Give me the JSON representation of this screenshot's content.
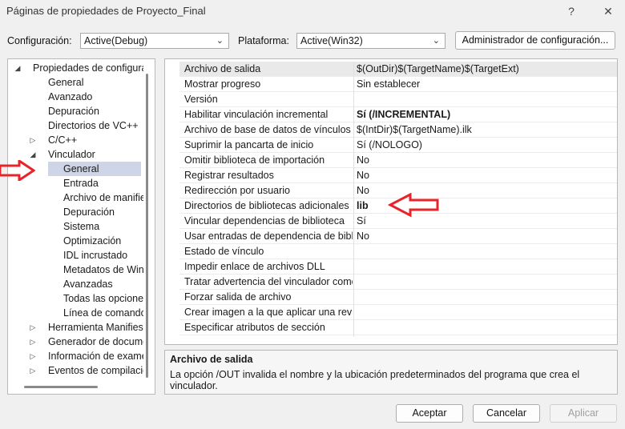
{
  "window": {
    "title": "Páginas de propiedades de Proyecto_Final",
    "help_icon": "?",
    "close_icon": "✕"
  },
  "toolbar": {
    "config_label": "Configuración:",
    "config_value": "Active(Debug)",
    "platform_label": "Plataforma:",
    "platform_value": "Active(Win32)",
    "config_manager_label": "Administrador de configuración..."
  },
  "tree": {
    "items": [
      {
        "label": "Propiedades de configuraci",
        "level": 0,
        "expander": "◢"
      },
      {
        "label": "General",
        "level": 1,
        "expander": ""
      },
      {
        "label": "Avanzado",
        "level": 1,
        "expander": ""
      },
      {
        "label": "Depuración",
        "level": 1,
        "expander": ""
      },
      {
        "label": "Directorios de VC++",
        "level": 1,
        "expander": ""
      },
      {
        "label": "C/C++",
        "level": 1,
        "expander": "▷"
      },
      {
        "label": "Vinculador",
        "level": 1,
        "expander": "◢"
      },
      {
        "label": "General",
        "level": 2,
        "expander": "",
        "selected": true
      },
      {
        "label": "Entrada",
        "level": 2,
        "expander": ""
      },
      {
        "label": "Archivo de manifies",
        "level": 2,
        "expander": ""
      },
      {
        "label": "Depuración",
        "level": 2,
        "expander": ""
      },
      {
        "label": "Sistema",
        "level": 2,
        "expander": ""
      },
      {
        "label": "Optimización",
        "level": 2,
        "expander": ""
      },
      {
        "label": "IDL incrustado",
        "level": 2,
        "expander": ""
      },
      {
        "label": "Metadatos de Windo",
        "level": 2,
        "expander": ""
      },
      {
        "label": "Avanzadas",
        "level": 2,
        "expander": ""
      },
      {
        "label": "Todas las opciones",
        "level": 2,
        "expander": ""
      },
      {
        "label": "Línea de comandos",
        "level": 2,
        "expander": ""
      },
      {
        "label": "Herramienta Manifiesto",
        "level": 1,
        "expander": "▷"
      },
      {
        "label": "Generador de documen",
        "level": 1,
        "expander": "▷"
      },
      {
        "label": "Información de examen",
        "level": 1,
        "expander": "▷"
      },
      {
        "label": "Eventos de compilación",
        "level": 1,
        "expander": "▷"
      }
    ]
  },
  "grid": {
    "rows": [
      {
        "name": "Archivo de salida",
        "value": "$(OutDir)$(TargetName)$(TargetExt)",
        "bold": false,
        "selected": true
      },
      {
        "name": "Mostrar progreso",
        "value": "Sin establecer",
        "bold": false
      },
      {
        "name": "Versión",
        "value": "",
        "bold": false
      },
      {
        "name": "Habilitar vinculación incremental",
        "value": "Sí (/INCREMENTAL)",
        "bold": true
      },
      {
        "name": "Archivo de base de datos de vínculos in",
        "value": "$(IntDir)$(TargetName).ilk",
        "bold": false
      },
      {
        "name": "Suprimir la pancarta de inicio",
        "value": "Sí (/NOLOGO)",
        "bold": false
      },
      {
        "name": "Omitir biblioteca de importación",
        "value": "No",
        "bold": false
      },
      {
        "name": "Registrar resultados",
        "value": "No",
        "bold": false
      },
      {
        "name": "Redirección por usuario",
        "value": "No",
        "bold": false
      },
      {
        "name": "Directorios de bibliotecas adicionales",
        "value": "lib",
        "bold": true
      },
      {
        "name": "Vincular dependencias de biblioteca",
        "value": "Sí",
        "bold": false
      },
      {
        "name": "Usar entradas de dependencia de bibliot",
        "value": "No",
        "bold": false
      },
      {
        "name": "Estado de vínculo",
        "value": "",
        "bold": false
      },
      {
        "name": "Impedir enlace de archivos DLL",
        "value": "",
        "bold": false
      },
      {
        "name": "Tratar advertencia del vinculador como",
        "value": "",
        "bold": false
      },
      {
        "name": "Forzar salida de archivo",
        "value": "",
        "bold": false
      },
      {
        "name": "Crear imagen a la que aplicar una revisió",
        "value": "",
        "bold": false
      },
      {
        "name": "Especificar atributos de sección",
        "value": "",
        "bold": false
      }
    ]
  },
  "description": {
    "title": "Archivo de salida",
    "text": "La opción /OUT invalida el nombre y la ubicación predeterminados del programa que crea el vinculador."
  },
  "footer": {
    "accept_label": "Aceptar",
    "cancel_label": "Cancelar",
    "apply_label": "Aplicar"
  },
  "colors": {
    "annotation_arrow": "#e8242a",
    "tree_selection": "#cdd5e6",
    "row_selection": "#e9e9e9"
  }
}
